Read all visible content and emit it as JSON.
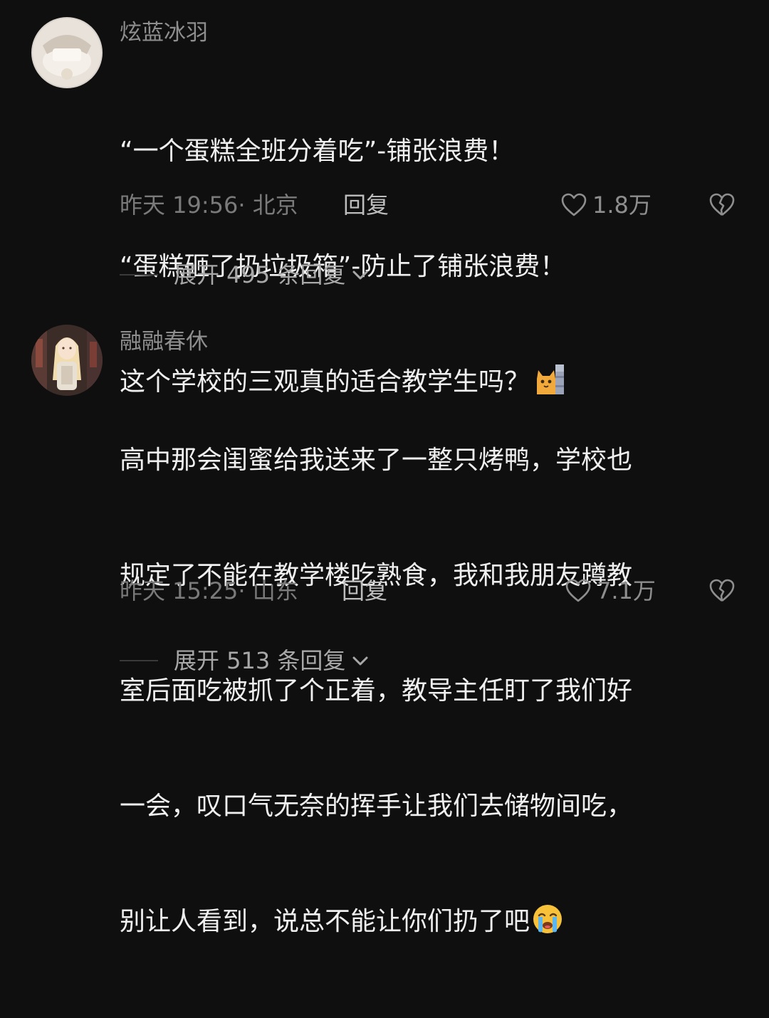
{
  "comments": [
    {
      "author": "炫蓝冰羽",
      "lines": [
        "“一个蛋糕全班分着吃”-铺张浪费！",
        "“蛋糕砸了扔垃圾箱”-防止了铺张浪费！",
        "这个学校的三观真的适合教学生吗？"
      ],
      "emoji": "cat-peek-emoji",
      "time": "昨天 19:56",
      "location": "· 北京",
      "reply_label": "回复",
      "likes": "1.8万",
      "expand_label": "展开 495 条回复"
    },
    {
      "author": "融融春休",
      "lines": [
        "高中那会闺蜜给我送来了一整只烤鸭，学校也",
        "规定了不能在教学楼吃熟食，我和我朋友蹲教",
        "室后面吃被抓了个正着，教导主任盯了我们好",
        "一会，叹口气无奈的挥手让我们去储物间吃，",
        "别让人看到，说总不能让你们扔了吧"
      ],
      "emoji": "crying-face-emoji",
      "time": "昨天 15:25",
      "location": "· 山东",
      "reply_label": "回复",
      "likes": "7.1万",
      "expand_label": "展开 513 条回复"
    }
  ],
  "colors": {
    "background": "#0f0f10",
    "text": "#f0f0f0",
    "muted": "#8e8e8e"
  }
}
